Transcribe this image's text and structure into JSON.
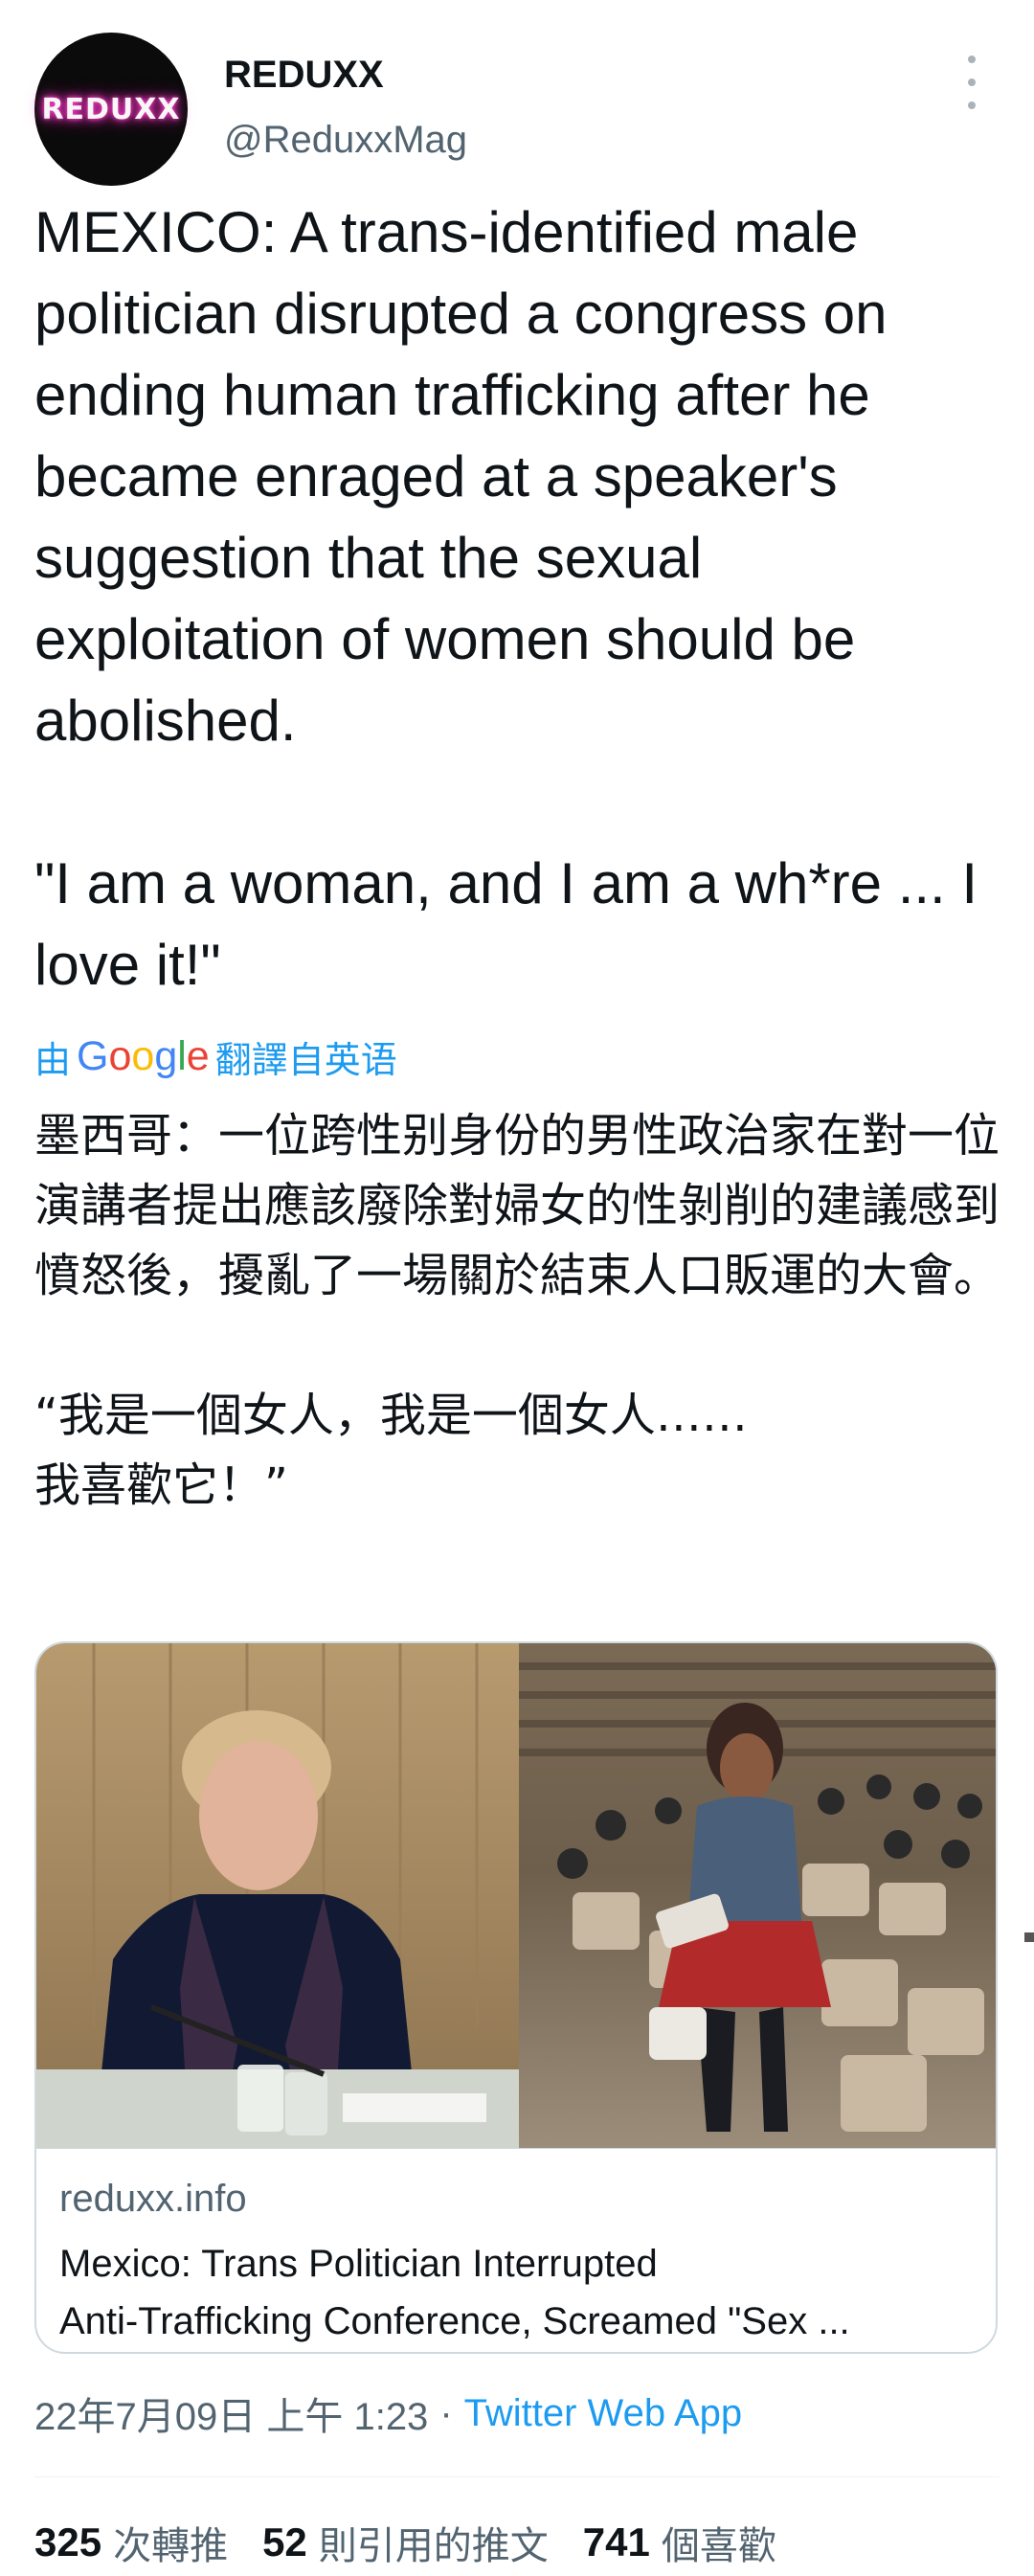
{
  "author": {
    "avatar_logo": "REDUXX",
    "name": "REDUXX",
    "handle": "@ReduxxMag"
  },
  "tweet": {
    "text": "MEXICO: A trans-identified male politician disrupted a congress on ending human trafficking after he became enraged at a speaker's suggestion that the sexual exploitation of women should be abolished.\n\n\"I am a woman, and I am a wh*re ... I love it!\""
  },
  "translation": {
    "prefix": "由",
    "provider": "Google",
    "suffix": "翻譯自英语",
    "text": "墨西哥：一位跨性别身份的男性政治家在對一位演講者提出應該廢除對婦女的性剝削的建議感到憤怒後，擾亂了一場關於結束人口販運的大會。\n\n“我是一個女人，我是一個女人……\n我喜歡它！”"
  },
  "card": {
    "domain": "reduxx.info",
    "title": "Mexico: Trans Politician Interrupted\nAnti-Trafficking Conference, Screamed \"Sex ..."
  },
  "meta": {
    "timestamp": "22年7月09日 上午 1:23",
    "separator": "·",
    "source": "Twitter Web App"
  },
  "stats": {
    "retweets_count": "325",
    "retweets_label": "次轉推",
    "quotes_count": "52",
    "quotes_label": "則引用的推文",
    "likes_count": "741",
    "likes_label": "個喜歡"
  },
  "colors": {
    "link_blue": "#1d9bf0",
    "secondary_text": "#536471",
    "primary_text": "#0f1419",
    "logo_glow": "#ff3ec8"
  }
}
